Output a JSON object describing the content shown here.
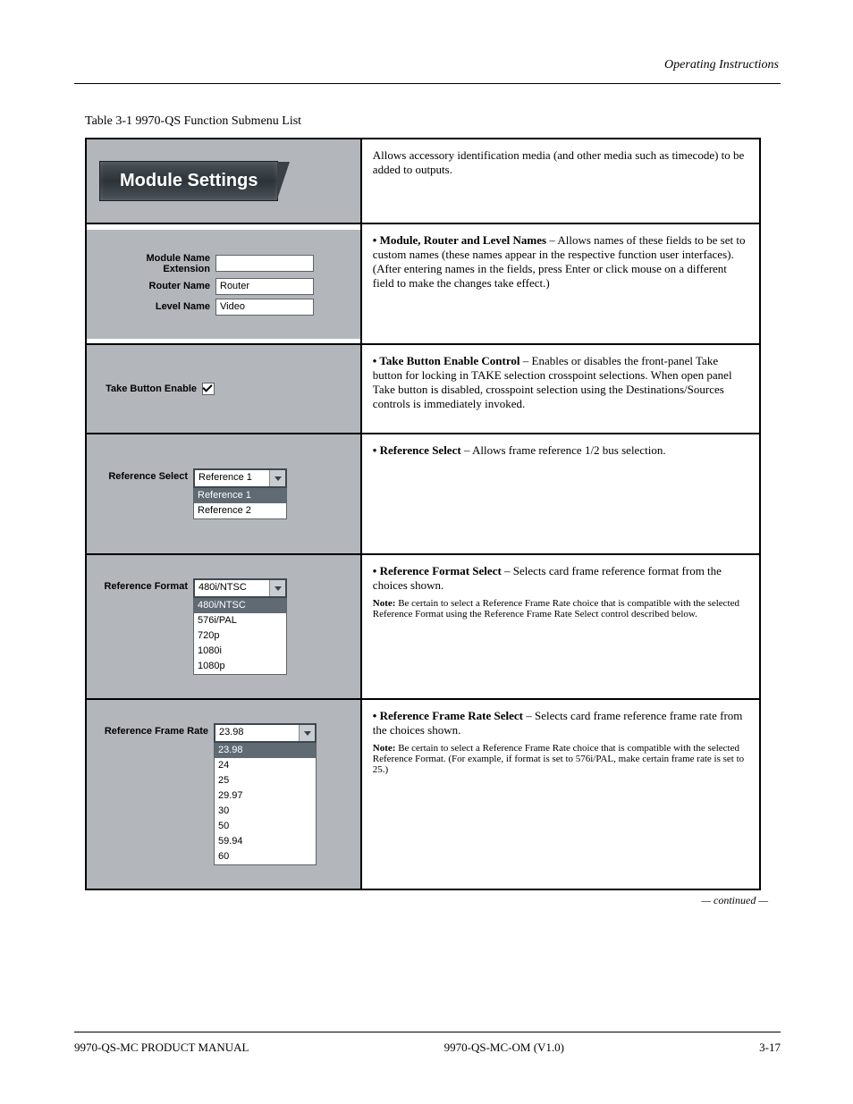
{
  "header": {
    "right": "Operating Instructions"
  },
  "intro": "Table 3-1   9970-QS Function Submenu List",
  "banner": "Module Settings",
  "desc_banner": "Allows accessory identification media (and other media such as timecode) to be added to outputs.",
  "fields": {
    "module_name_ext": {
      "label": "Module Name Extension",
      "value": ""
    },
    "router_name": {
      "label": "Router Name",
      "value": "Router"
    },
    "level_name": {
      "label": "Level Name",
      "value": "Video"
    },
    "take_enable": {
      "label": "Take Button Enable",
      "checked": true
    },
    "ref_select": {
      "label": "Reference Select",
      "value": "Reference 1",
      "options": [
        "Reference 1",
        "Reference 2"
      ]
    },
    "ref_format": {
      "label": "Reference Format",
      "value": "480i/NTSC",
      "options": [
        "480i/NTSC",
        "576i/PAL",
        "720p",
        "1080i",
        "1080p"
      ]
    },
    "ref_frame_rate": {
      "label": "Reference Frame Rate",
      "value": "23.98",
      "options": [
        "23.98",
        "24",
        "25",
        "29.97",
        "30",
        "50",
        "59.94",
        "60"
      ]
    }
  },
  "desc": {
    "names": {
      "title": "Module, Router and Level Names",
      "body": "Allows names of these fields to be set to custom names (these names appear in the respective function user interfaces). (After entering names in the fields, press Enter or click mouse on a different field to make the changes take effect.)"
    },
    "take": {
      "title": "Take Button Enable Control",
      "body": "Enables or disables the front-panel Take button for locking in TAKE selection crosspoint selections. When open panel Take button is disabled, crosspoint selection using the Destinations/Sources controls is immediately invoked."
    },
    "ref_select": {
      "title": "Reference Select",
      "body": "Allows frame reference 1/2 bus selection."
    },
    "ref_format": {
      "title": "Reference Format Select",
      "body": "Selects card frame reference format from the choices shown.",
      "note_label": "Note:",
      "note": "Be certain to select a Reference Frame Rate choice that is compatible with the selected Reference Format using the Reference Frame Rate Select control described below."
    },
    "ref_rate": {
      "title": "Reference Frame Rate Select",
      "body": "Selects card frame reference frame rate from the choices shown.",
      "note_label": "Note:",
      "note": "Be certain to select a Reference Frame Rate choice that is compatible with the selected Reference Format. (For example, if format is set to 576i/PAL, make certain frame rate is set to 25.)"
    }
  },
  "continued": "— continued —",
  "footer": {
    "left": "9970-QS-MC PRODUCT MANUAL",
    "center": "9970-QS-MC-OM (V1.0)",
    "right": "3-17"
  }
}
